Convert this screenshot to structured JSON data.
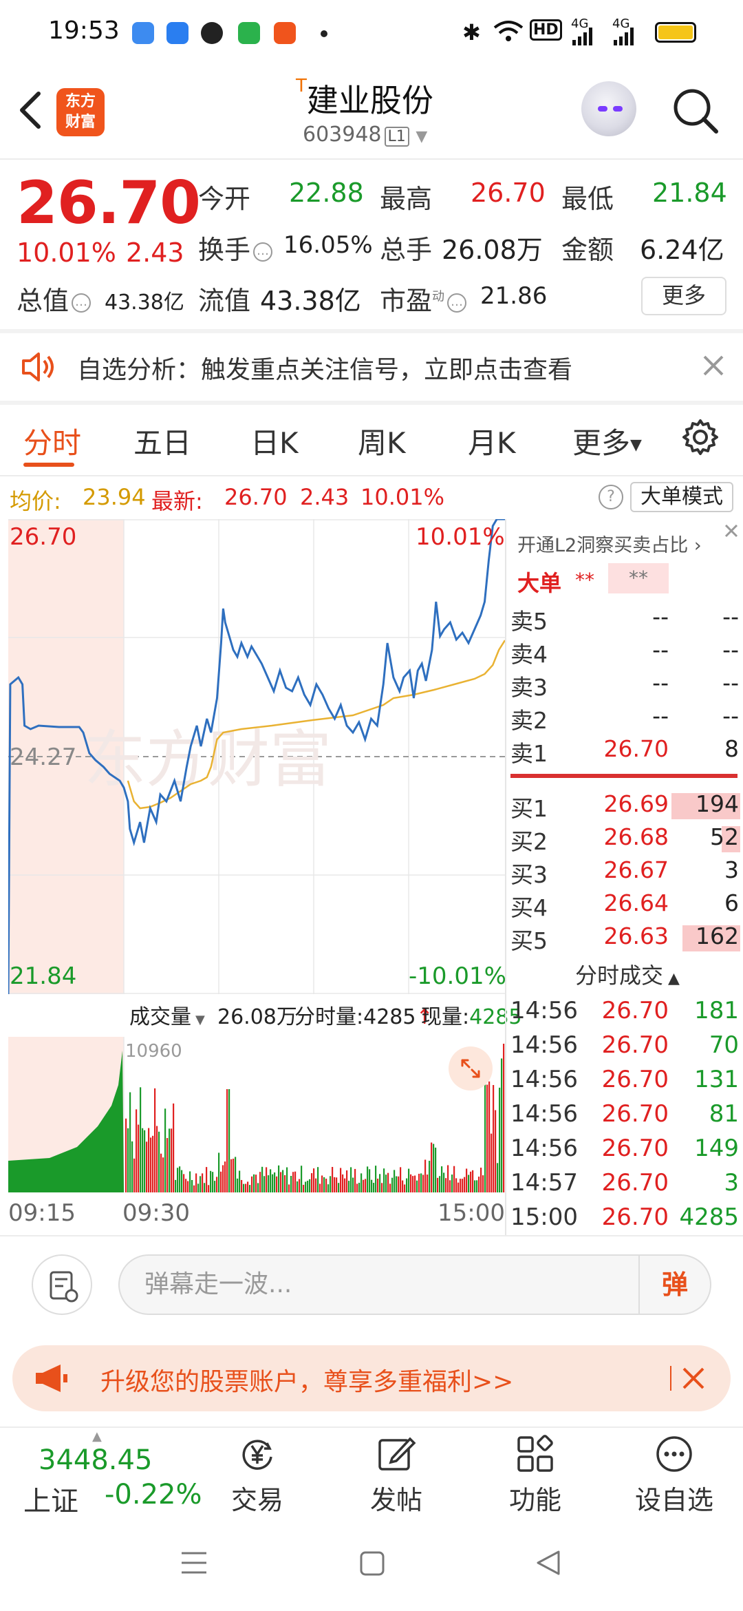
{
  "status_bar": {
    "time": "19:53",
    "hd": "HD",
    "net1": "4G",
    "net2": "4G"
  },
  "header": {
    "back_label": "",
    "logo_line1": "东方",
    "logo_line2": "财富",
    "stock_flag": "T",
    "stock_name": "建业股份",
    "stock_code": "603948",
    "level_badge": "L1"
  },
  "quote": {
    "price": "26.70",
    "pct_change": "10.01%",
    "change": "2.43",
    "open_label": "今开",
    "open": "22.88",
    "high_label": "最高",
    "high": "26.70",
    "low_label": "最低",
    "low": "21.84",
    "turnover_label": "换手",
    "turnover": "16.05%",
    "volume_label": "总手",
    "volume": "26.08万",
    "amount_label": "金额",
    "amount": "6.24亿",
    "total_mv_label": "总值",
    "total_mv": "43.38亿",
    "float_mv_label": "流值",
    "float_mv": "43.38亿",
    "pe_label": "市盈",
    "pe_sup": "动",
    "pe": "21.86",
    "more_label": "更多"
  },
  "alert": {
    "text": "自选分析：触发重点关注信号，立即点击查看"
  },
  "tabs": [
    {
      "label": "分时",
      "active": true
    },
    {
      "label": "五日",
      "active": false
    },
    {
      "label": "日K",
      "active": false
    },
    {
      "label": "周K",
      "active": false
    },
    {
      "label": "月K",
      "active": false
    },
    {
      "label": "更多",
      "active": false
    }
  ],
  "chart_info": {
    "avg_label": "均价:",
    "avg": "23.94",
    "latest_label": "最新:",
    "latest": "26.70",
    "change": "2.43",
    "pct": "10.01%",
    "help": "?",
    "mode_label": "大单模式"
  },
  "chart_labels": {
    "top_price": "26.70",
    "top_pct": "10.01%",
    "mid_price": "24.27",
    "bottom_price": "21.84",
    "bottom_pct": "-10.01%",
    "vol_max": "10960",
    "watermark": "东方财富"
  },
  "volume_header": {
    "label": "成交量",
    "total": "26.08万",
    "minute_label": "分时量:",
    "minute": "4285",
    "current_label": "现量:",
    "current": "4285"
  },
  "time_axis": [
    "09:15",
    "09:30",
    "15:00"
  ],
  "order_book": {
    "promo": "开通L2洞察买卖占比",
    "big_label": "大单",
    "stars1": "**",
    "stars2": "**",
    "asks": [
      {
        "label": "卖5",
        "price": "--",
        "vol": "--"
      },
      {
        "label": "卖4",
        "price": "--",
        "vol": "--"
      },
      {
        "label": "卖3",
        "price": "--",
        "vol": "--"
      },
      {
        "label": "卖2",
        "price": "--",
        "vol": "--"
      },
      {
        "label": "卖1",
        "price": "26.70",
        "vol": "8"
      }
    ],
    "bids": [
      {
        "label": "买1",
        "price": "26.69",
        "vol": "194",
        "bar": 1.0
      },
      {
        "label": "买2",
        "price": "26.68",
        "vol": "52",
        "bar": 0.27
      },
      {
        "label": "买3",
        "price": "26.67",
        "vol": "3",
        "bar": 0.0
      },
      {
        "label": "买4",
        "price": "26.64",
        "vol": "6",
        "bar": 0.0
      },
      {
        "label": "买5",
        "price": "26.63",
        "vol": "162",
        "bar": 0.84
      }
    ],
    "ticks_header": "分时成交",
    "ticks": [
      {
        "time": "14:56",
        "price": "26.70",
        "vol": "181"
      },
      {
        "time": "14:56",
        "price": "26.70",
        "vol": "70"
      },
      {
        "time": "14:56",
        "price": "26.70",
        "vol": "131"
      },
      {
        "time": "14:56",
        "price": "26.70",
        "vol": "81"
      },
      {
        "time": "14:56",
        "price": "26.70",
        "vol": "149"
      },
      {
        "time": "14:57",
        "price": "26.70",
        "vol": "3"
      },
      {
        "time": "15:00",
        "price": "26.70",
        "vol": "4285"
      }
    ]
  },
  "danmaku": {
    "placeholder": "弹幕走一波...",
    "button": "弹"
  },
  "promo_banner": {
    "text": "升级您的股票账户，尊享多重福利>>"
  },
  "bottom_nav": {
    "index_value": "3448.45",
    "index_name": "上证",
    "index_change": "-0.22%",
    "items": [
      {
        "label": "交易",
        "icon": "yen-icon"
      },
      {
        "label": "发帖",
        "icon": "edit-icon"
      },
      {
        "label": "功能",
        "icon": "grid-icon"
      },
      {
        "label": "设自选",
        "icon": "more-circle-icon"
      }
    ]
  }
}
